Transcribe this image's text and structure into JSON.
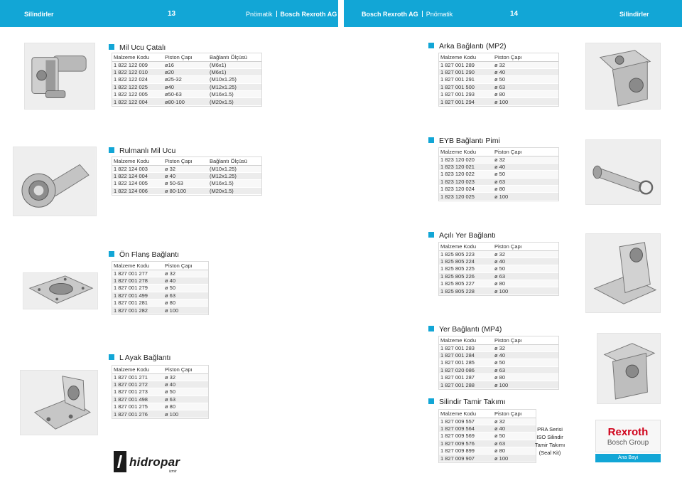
{
  "header": {
    "left_section": "Silindirler",
    "left_page": "13",
    "left_brand_1": "Pnömatik",
    "left_brand_2": "Bosch Rexroth AG",
    "right_brand_1": "Bosch Rexroth AG",
    "right_brand_2": "Pnömatik",
    "right_page": "14",
    "right_section": "Silindirler"
  },
  "mil_ucu_catali": {
    "title": "Mil Ucu Çatalı",
    "headers": [
      "Malzeme Kodu",
      "Piston Çapı",
      "Bağlantı Ölçüsü"
    ],
    "rows": [
      [
        "1 822 122 009",
        "ø16",
        "(M6x1)"
      ],
      [
        "1 822 122 010",
        "ø20",
        "(M6x1)"
      ],
      [
        "1 822 122 024",
        "ø25-32",
        "(M10x1.25)"
      ],
      [
        "1 822 122 025",
        "ø40",
        "(M12x1.25)"
      ],
      [
        "1 822 122 005",
        "ø50-63",
        "(M16x1.5)"
      ],
      [
        "1 822 122 004",
        "ø80-100",
        "(M20x1.5)"
      ]
    ]
  },
  "rulmanli_mil_ucu": {
    "title": "Rulmanlı Mil Ucu",
    "headers": [
      "Malzeme Kodu",
      "Piston Çapı",
      "Bağlantı Ölçüsü"
    ],
    "rows": [
      [
        "1 822 124 003",
        "ø 32",
        "(M10x1.25)"
      ],
      [
        "1 822 124 004",
        "ø 40",
        "(M12x1.25)"
      ],
      [
        "1 822 124 005",
        "ø 50-63",
        "(M16x1.5)"
      ],
      [
        "1 822 124 006",
        "ø 80-100",
        "(M20x1.5)"
      ]
    ]
  },
  "on_flans": {
    "title": "Ön Flanş Bağlantı",
    "headers": [
      "Malzeme Kodu",
      "Piston Çapı"
    ],
    "rows": [
      [
        "1 827 001 277",
        "ø 32"
      ],
      [
        "1 827 001 278",
        "ø 40"
      ],
      [
        "1 827 001 279",
        "ø 50"
      ],
      [
        "1 827 001 499",
        "ø 63"
      ],
      [
        "1 827 001 281",
        "ø 80"
      ],
      [
        "1 827 001 282",
        "ø 100"
      ]
    ]
  },
  "l_ayak": {
    "title": "L Ayak Bağlantı",
    "headers": [
      "Malzeme Kodu",
      "Piston Çapı"
    ],
    "rows": [
      [
        "1 827 001 271",
        "ø 32"
      ],
      [
        "1 827 001 272",
        "ø 40"
      ],
      [
        "1 827 001 273",
        "ø 50"
      ],
      [
        "1 827 001 498",
        "ø 63"
      ],
      [
        "1 827 001 275",
        "ø 80"
      ],
      [
        "1 827 001 276",
        "ø 100"
      ]
    ]
  },
  "arka_baglanti": {
    "title": "Arka Bağlantı (MP2)",
    "headers": [
      "Malzeme Kodu",
      "Piston Çapı"
    ],
    "rows": [
      [
        "1 827 001 289",
        "ø 32"
      ],
      [
        "1 827 001 290",
        "ø 40"
      ],
      [
        "1 827 001 291",
        "ø 50"
      ],
      [
        "1 827 001 500",
        "ø 63"
      ],
      [
        "1 827 001 293",
        "ø 80"
      ],
      [
        "1 827 001 294",
        "ø 100"
      ]
    ]
  },
  "eyb_pimi": {
    "title": "EYB Bağlantı Pimi",
    "headers": [
      "Malzeme Kodu",
      "Piston Çapı"
    ],
    "rows": [
      [
        "1 823 120 020",
        "ø 32"
      ],
      [
        "1 823 120 021",
        "ø 40"
      ],
      [
        "1 823 120 022",
        "ø 50"
      ],
      [
        "1 823 120 023",
        "ø 63"
      ],
      [
        "1 823 120 024",
        "ø 80"
      ],
      [
        "1 823 120 025",
        "ø 100"
      ]
    ]
  },
  "acili_yer": {
    "title": "Açılı Yer Bağlantı",
    "headers": [
      "Malzeme Kodu",
      "Piston Çapı"
    ],
    "rows": [
      [
        "1 825 805 223",
        "ø 32"
      ],
      [
        "1 825 805 224",
        "ø 40"
      ],
      [
        "1 825 805 225",
        "ø 50"
      ],
      [
        "1 825 805 226",
        "ø 63"
      ],
      [
        "1 825 805 227",
        "ø 80"
      ],
      [
        "1 825 805 228",
        "ø 100"
      ]
    ]
  },
  "yer_baglanti": {
    "title": "Yer Bağlantı (MP4)",
    "headers": [
      "Malzeme Kodu",
      "Piston Çapı"
    ],
    "rows": [
      [
        "1 827 001 283",
        "ø 32"
      ],
      [
        "1 827 001 284",
        "ø 40"
      ],
      [
        "1 827 001 285",
        "ø 50"
      ],
      [
        "1 827 020 086",
        "ø 63"
      ],
      [
        "1 827 001 287",
        "ø 80"
      ],
      [
        "1 827 001 288",
        "ø 100"
      ]
    ]
  },
  "tamir_takimi": {
    "title": "Silindir Tamir Takımı",
    "headers": [
      "Malzeme Kodu",
      "Piston Çapı"
    ],
    "rows": [
      [
        "1 827 009 557",
        "ø 32"
      ],
      [
        "1 827 009 564",
        "ø 40"
      ],
      [
        "1 827 009 569",
        "ø 50"
      ],
      [
        "1 827 009 576",
        "ø 63"
      ],
      [
        "1 827 009 899",
        "ø 80"
      ],
      [
        "1 827 009 907",
        "ø 100"
      ]
    ],
    "note_lines": [
      "PRA Serisi",
      "ISO Silindir",
      "Tamir Takımı",
      "(Seal Kit)"
    ]
  },
  "rexroth_logo": {
    "brand": "Rexroth",
    "group": "Bosch Group",
    "dealer": "Ana Bayi"
  },
  "hidropar_logo": {
    "name": "hidropar",
    "city": "izmir"
  },
  "colors": {
    "accent": "#12a6d6",
    "rexroth_red": "#d0021b"
  },
  "icons": [
    "section-square-icon",
    "rod-clevis-photo",
    "rod-eye-photo",
    "front-flange-photo",
    "foot-mount-photo",
    "rear-clevis-photo",
    "pin-photo",
    "angled-mount-photo",
    "floor-mount-photo"
  ]
}
